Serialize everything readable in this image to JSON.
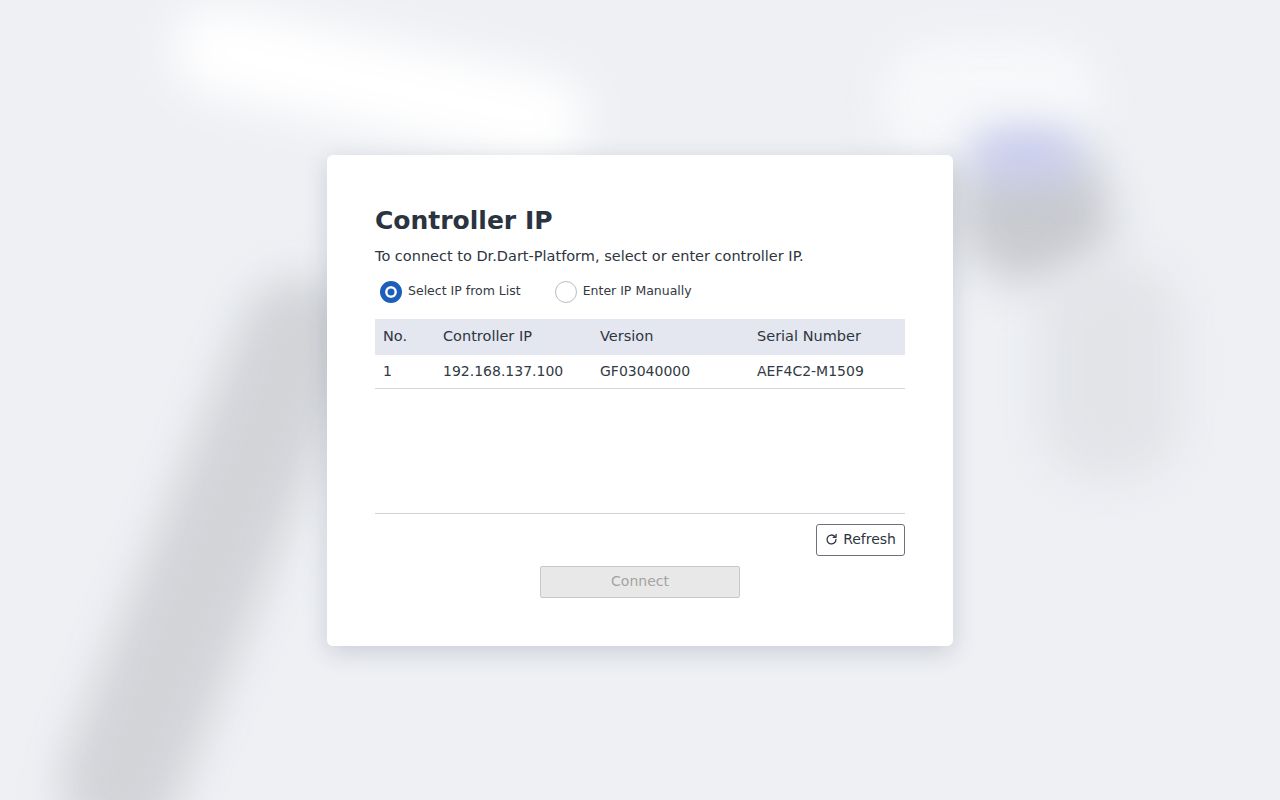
{
  "dialog": {
    "title": "Controller IP",
    "subtitle": "To connect to Dr.Dart-Platform, select or enter controller IP."
  },
  "modes": [
    {
      "label": "Select IP from List",
      "selected": true
    },
    {
      "label": "Enter IP Manually",
      "selected": false
    }
  ],
  "table": {
    "columns": [
      "No.",
      "Controller IP",
      "Version",
      "Serial Number"
    ],
    "rows": [
      {
        "cells": [
          "1",
          "192.168.137.100",
          "GF03040000",
          "AEF4C2-M1509"
        ],
        "selected": false
      }
    ]
  },
  "refresh": {
    "label": "Refresh"
  },
  "connect": {
    "label": "Connect",
    "disabled": true
  }
}
